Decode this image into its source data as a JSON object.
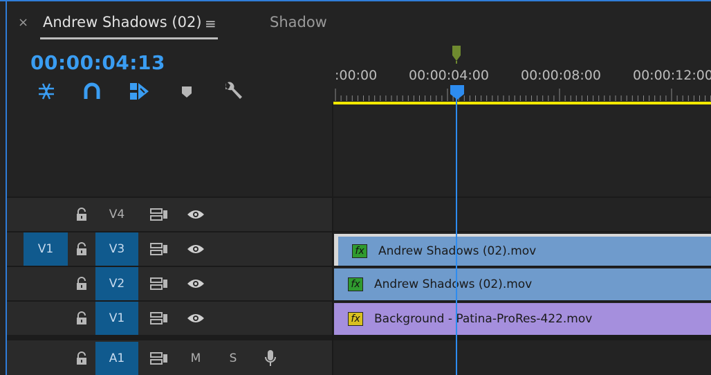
{
  "panel": {
    "close_glyph": "×",
    "title": "Andrew Shadows (02)",
    "menu_glyph": "≡",
    "other_tab": "Shadow"
  },
  "timecode": "00:00:04:13",
  "toolbar": {
    "icons": [
      "nest-sequence-icon",
      "snap-magnet-icon",
      "linked-selection-icon",
      "add-marker-icon",
      "wrench-settings-icon"
    ]
  },
  "ruler": {
    "labels": [
      ":00:00",
      "00:00:04:00",
      "00:00:08:00",
      "00:00:12:00"
    ]
  },
  "tracks": [
    {
      "id": "V4",
      "source": "",
      "target_on": false
    },
    {
      "id": "V3",
      "source": "V1",
      "target_on": true
    },
    {
      "id": "V2",
      "source": "",
      "target_on": true
    },
    {
      "id": "V1",
      "source": "",
      "target_on": true
    },
    {
      "id": "A1",
      "source": "",
      "target_on": true,
      "mute": "M",
      "solo": "S"
    }
  ],
  "clips": [
    {
      "track": "V3",
      "name": "Andrew Shadows (02).mov",
      "fx": "fx",
      "color": "#6f9bcc",
      "fx_color": "#2f9a2f"
    },
    {
      "track": "V2",
      "name": "Andrew Shadows (02).mov",
      "fx": "fx",
      "color": "#6f9bcc",
      "fx_color": "#2f9a2f"
    },
    {
      "track": "V1",
      "name": "Background - Patina-ProRes-422.mov",
      "fx": "fx",
      "color": "#a58fdd",
      "fx_color": "#d8c020"
    }
  ],
  "colors": {
    "accent": "#3a9df2",
    "work_area_bar": "#f2e800",
    "track_target": "#105a8e",
    "playhead_marker": "#6f8a2f"
  }
}
